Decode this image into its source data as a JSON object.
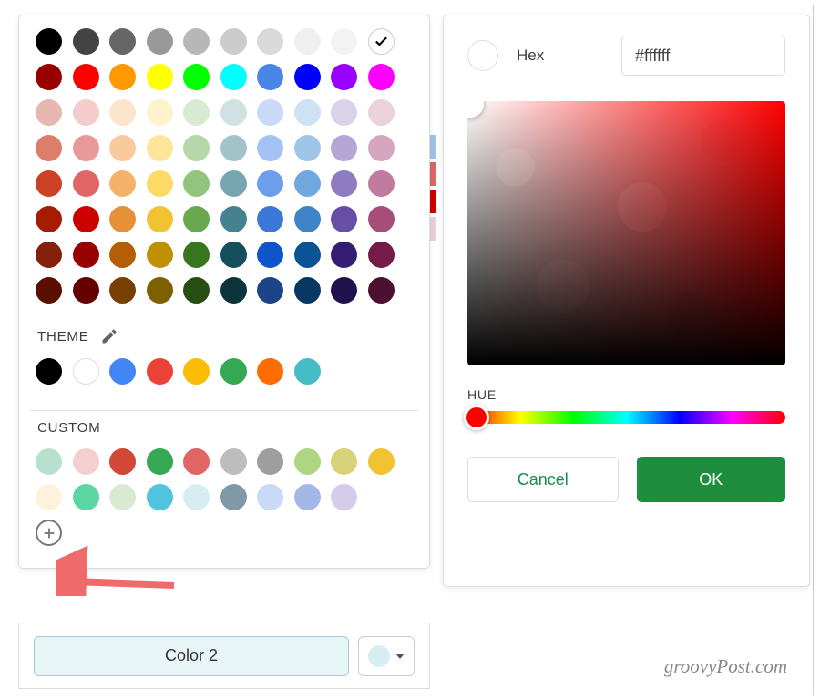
{
  "palette": {
    "standard_rows": [
      [
        "#000000",
        "#434343",
        "#666666",
        "#999999",
        "#b7b7b7",
        "#cccccc",
        "#d9d9d9",
        "#efefef",
        "#f3f3f3",
        "#ffffff"
      ],
      [
        "#980000",
        "#ff0000",
        "#ff9900",
        "#ffff00",
        "#00ff00",
        "#00ffff",
        "#4a86e8",
        "#0000ff",
        "#9900ff",
        "#ff00ff"
      ],
      [
        "#e6b8af",
        "#f4cccc",
        "#fce5cd",
        "#fff2cc",
        "#d9ead3",
        "#d0e0e3",
        "#c9daf8",
        "#cfe2f3",
        "#d9d2e9",
        "#ead1dc"
      ],
      [
        "#dd7e6b",
        "#ea9999",
        "#f9cb9c",
        "#ffe599",
        "#b6d7a8",
        "#a2c4c9",
        "#a4c2f4",
        "#9fc5e8",
        "#b4a7d6",
        "#d5a6bd"
      ],
      [
        "#cc4125",
        "#e06666",
        "#f6b26b",
        "#ffd966",
        "#93c47d",
        "#76a5af",
        "#6d9eeb",
        "#6fa8dc",
        "#8e7cc3",
        "#c27ba0"
      ],
      [
        "#a61c00",
        "#cc0000",
        "#e69138",
        "#f1c232",
        "#6aa84f",
        "#45818e",
        "#3c78d8",
        "#3d85c6",
        "#674ea7",
        "#a64d79"
      ],
      [
        "#85200c",
        "#990000",
        "#b45f06",
        "#bf9000",
        "#38761d",
        "#134f5c",
        "#1155cc",
        "#0b5394",
        "#351c75",
        "#741b47"
      ],
      [
        "#5b0f00",
        "#660000",
        "#783f04",
        "#7f6000",
        "#274e13",
        "#0c343d",
        "#1c4587",
        "#073763",
        "#20124d",
        "#4c1130"
      ]
    ],
    "selected_index": [
      0,
      9
    ]
  },
  "theme": {
    "label": "THEME",
    "colors": [
      "#000000",
      "#ffffff",
      "#4285f4",
      "#ea4335",
      "#fbbc04",
      "#34a853",
      "#ff6d01",
      "#46bdc6"
    ]
  },
  "custom": {
    "label": "CUSTOM",
    "rows": [
      [
        "#b8e0cf",
        "#f4cfcf",
        "#d14836",
        "#34a853",
        "#e06666",
        "#bdbdbd",
        "#9e9e9e",
        "#aed581",
        "#d8d27a",
        "#f1c232"
      ],
      [
        "#fff2dc",
        "#5cd6a3",
        "#d9ead3",
        "#4fc3e0",
        "#d6eef2",
        "#7f9aa6",
        "#c9daf8",
        "#a4b8e8",
        "#d5ccec",
        ""
      ]
    ]
  },
  "picker": {
    "button_label": "Color 2",
    "swatch_color": "#d6eef2"
  },
  "hex_panel": {
    "hex_label": "Hex",
    "hex_value": "#ffffff",
    "hue_label": "HUE",
    "cancel_label": "Cancel",
    "ok_label": "OK"
  },
  "watermark": "groovyPost.com",
  "side_strip": [
    "#9fc5e8",
    "#e06666",
    "#cc0000",
    "#ead1dc"
  ]
}
